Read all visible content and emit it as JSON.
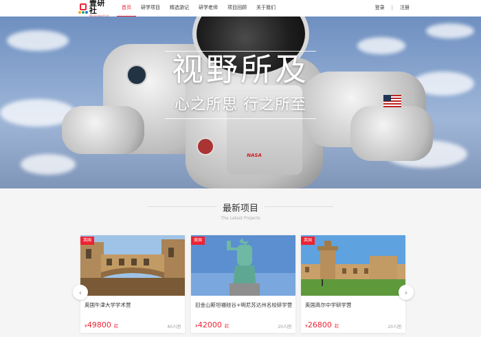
{
  "header": {
    "logo_cn": "壹研社",
    "logo_en": "YoungsterClub",
    "nav": [
      "首页",
      "研学项目",
      "精选游记",
      "研学老师",
      "项目回顾",
      "关于我们"
    ],
    "active_index": 0,
    "login": "登录",
    "separator": "|",
    "register": "注册"
  },
  "hero": {
    "title": "视野所及",
    "subtitle": "心之所思 行之所至",
    "patch_text": "NASA"
  },
  "section": {
    "title": "最新项目",
    "subtitle": "The Latest Projects"
  },
  "cards": [
    {
      "tag": "英国",
      "name": "英国牛津大学学术营",
      "currency": "¥",
      "price": "49800",
      "unit": "起",
      "group": "40人团"
    },
    {
      "tag": "美国",
      "name": "旧金山斯坦福硅谷+明尼苏达州名校研学营",
      "currency": "¥",
      "price": "42000",
      "unit": "起",
      "group": "20人团"
    },
    {
      "tag": "英国",
      "name": "英国高尔中学研学营",
      "currency": "¥",
      "price": "26800",
      "unit": "起",
      "group": "20人团"
    }
  ],
  "carousel": {
    "prev_icon": "chevron-left-icon",
    "next_icon": "chevron-right-icon"
  },
  "colors": {
    "accent": "#e22233"
  }
}
